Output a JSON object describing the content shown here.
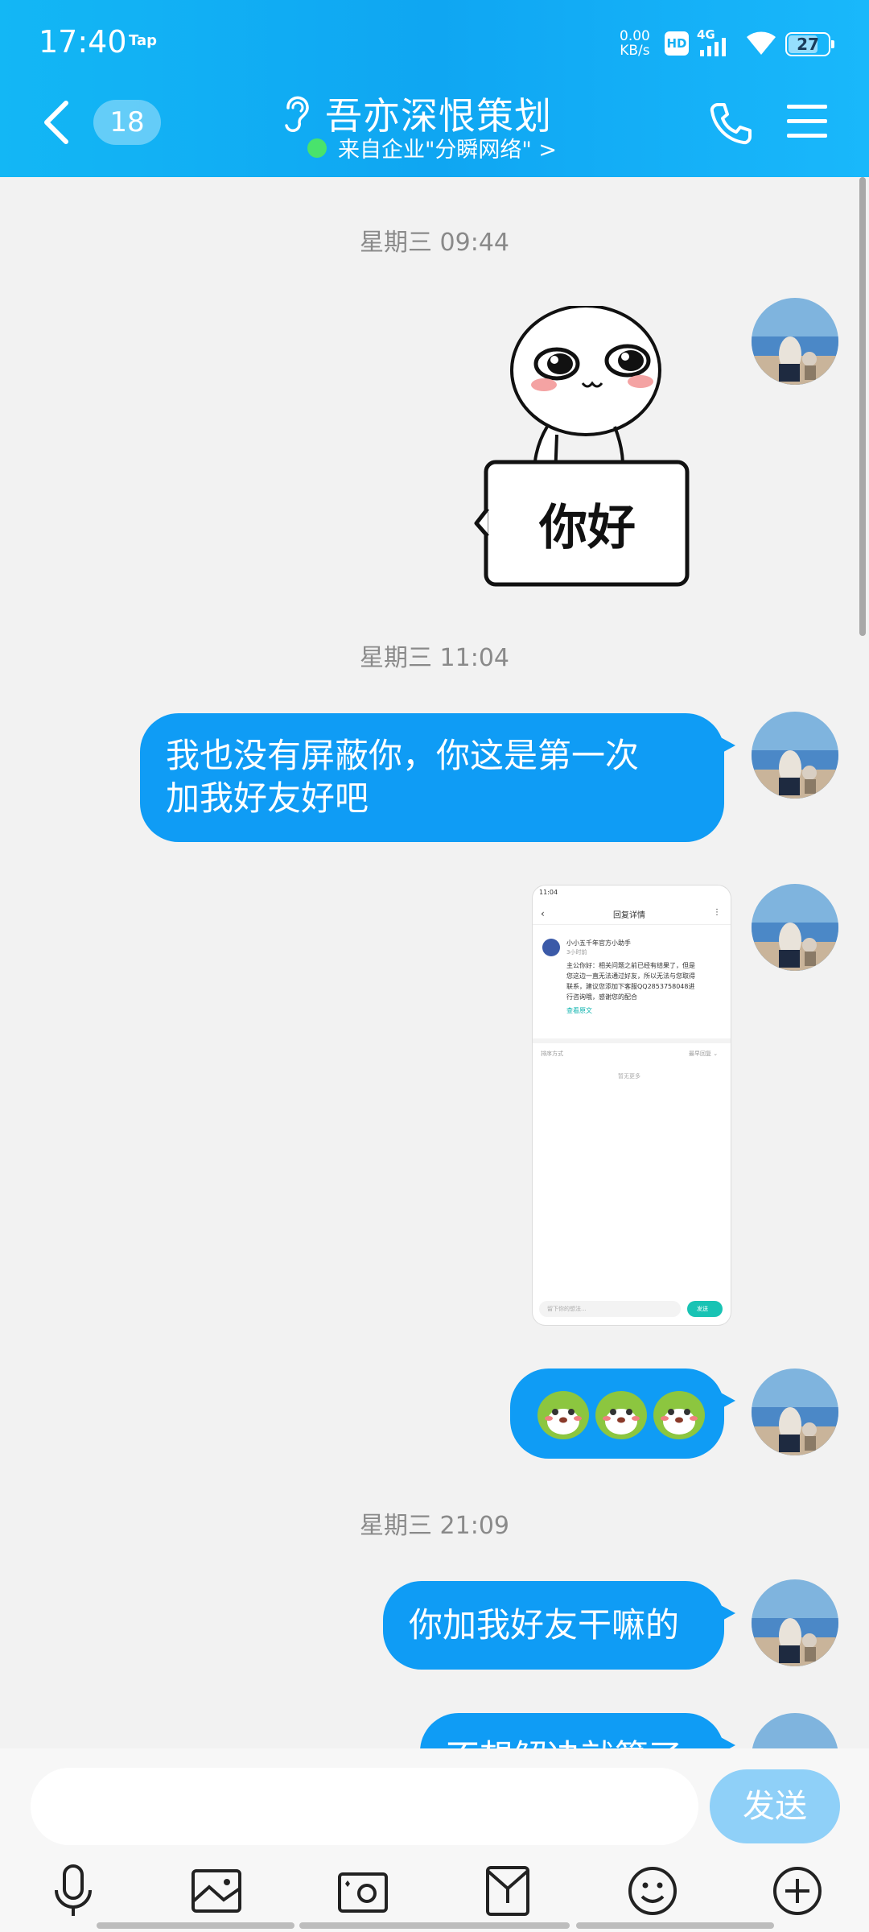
{
  "status_bar": {
    "time": "17:40",
    "tap_label": "Tap",
    "speed_value": "0.00",
    "speed_unit": "KB/s",
    "hd": "HD",
    "network": "4G",
    "battery": "27"
  },
  "header": {
    "unread_count": "18",
    "title": "吾亦深恨策划",
    "subtitle": "来自企业\"分瞬网络\" >"
  },
  "messages": {
    "ts1": "星期三 09:44",
    "sticker_text": "你好",
    "ts2": "星期三 11:04",
    "msg1_line1": "我也没有屏蔽你，你这是第一次",
    "msg1_line2": "加我好友好吧",
    "ts3": "星期三 21:09",
    "msg3": "你加我好友干嘛的",
    "msg4_partial": "不想解决就算了"
  },
  "screenshot": {
    "time": "11:04",
    "title": "回复详情",
    "author": "小小五千年官方小助手",
    "posted": "3小时前",
    "body_line1": "主公你好：相关问题之前已经有结果了，但是",
    "body_line2": "您这边一直无法通过好友，所以无法与您取得",
    "body_line3": "联系，建议您添加下客服QQ2853758048进",
    "body_line4": "行咨询哦，感谢您的配合",
    "view_original": "查看原文",
    "sort_label": "排序方式",
    "sort_value": "最早回复 ⌄",
    "no_more": "暂无更多",
    "reply_placeholder": "留下你的想法...",
    "send": "发送"
  },
  "input": {
    "placeholder": "",
    "send_label": "发送"
  },
  "colors": {
    "header": "#13b7f5",
    "bubble": "#0f9cf5",
    "send_button": "#8fd0f8",
    "online": "#49e36c"
  },
  "toolbar_icons": [
    "mic-icon",
    "image-icon",
    "camera-icon",
    "red-packet-icon",
    "emoji-icon",
    "plus-icon"
  ]
}
